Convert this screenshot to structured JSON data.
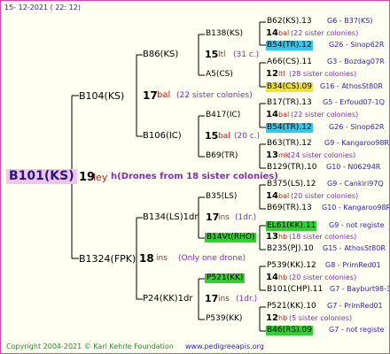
{
  "date": "15- 12-2021 ( 22: 12)",
  "footer": {
    "copyright": "Copyright 2004-2021 © Karl Kehrle Foundation",
    "site": "www.pedigreeapis.org"
  },
  "root": {
    "id": "B101(KS)",
    "num": "19",
    "mark": "ley",
    "note": "h(Drones from 18 sister colonies)"
  },
  "gen1": [
    {
      "id": "B104(KS)",
      "num": "17",
      "mark": "bal",
      "note": "(22 sister colonies)"
    },
    {
      "id": "B1324(FPK)",
      "num": "18",
      "mark": "ins",
      "note": "(Only one drone)"
    }
  ],
  "gen2": [
    {
      "id": "B86(KS)",
      "num": "15",
      "mark": "ltl",
      "note": "(31 c.)"
    },
    {
      "id": "B106(IC)",
      "num": "15",
      "mark": "bal",
      "note": "(20 c.)"
    },
    {
      "id": "B134(LS)1dr",
      "num": "17",
      "mark": "ins",
      "note": "(1dr.)"
    },
    {
      "id": "P24(KK)1dr",
      "num": "17",
      "mark": "ins",
      "note": "(1dr.)"
    }
  ],
  "gen3": [
    {
      "id": "B138(KS)",
      "num": "14",
      "mark": "bal",
      "note": "(22 sister colonies)"
    },
    {
      "id": "A5(CS)",
      "num": "12",
      "mark": "ltl",
      "note": "(28 sister colonies)"
    },
    {
      "id": "B417(IC)",
      "num": "14",
      "mark": "bal",
      "note": "(22 sister colonies)"
    },
    {
      "id": "B69(TR)",
      "num": "13",
      "mark": "mk",
      "note": "(24 sister colonies)"
    },
    {
      "id": "B35(LS)",
      "num": "14",
      "mark": "bal",
      "note": "(20 sister colonies)"
    },
    {
      "id": "B14Vt(RHO)",
      "num": "13",
      "mark": "hb",
      "note": "(18 sister colonies)"
    },
    {
      "id": "P521(KK)",
      "num": "14",
      "mark": "hb",
      "note": "(20 sister colonies)"
    },
    {
      "id": "P539(KK)",
      "num": "12",
      "mark": "hb",
      "note": "(5 sister colonies)"
    }
  ],
  "gen4": [
    {
      "id": "B62(KS).13",
      "info": "G6 - B37(KS)"
    },
    {
      "id": "B54(TR).12",
      "info": "G26 - Sinop62R"
    },
    {
      "id": "A66(CS).11",
      "info": "G3 - Bozdag07R"
    },
    {
      "id": "B34(CS).09",
      "info": "G16 - AthosSt80R"
    },
    {
      "id": "B17(TR).13",
      "info": "G5 - Erfoud07-1Q"
    },
    {
      "id": "B54(TR).12",
      "info": "G26 - Sinop62R"
    },
    {
      "id": "B63(TR).12",
      "info": "G9 - Kangaroo98R"
    },
    {
      "id": "B129(TR).10",
      "info": "G10 - N06294R"
    },
    {
      "id": "B375(LS).12",
      "info": "G9 - Cankiri97Q"
    },
    {
      "id": "B69(TR).13",
      "info": "G10 - Kangaroo98R"
    },
    {
      "id": "EL61(KK).11",
      "info": "G9 - not registe"
    },
    {
      "id": "B235(PJ).10",
      "info": "G15 - AthosSt80R"
    },
    {
      "id": "P539(KK).12",
      "info": "G8 - PrimRed01"
    },
    {
      "id": "B101(CHP).11",
      "info": "G7 - Bayburt98-3"
    },
    {
      "id": "P521(KK).10",
      "info": "G7 - PrimRed01"
    },
    {
      "id": "B46(RS).09",
      "info": "G7 - not registe"
    }
  ]
}
